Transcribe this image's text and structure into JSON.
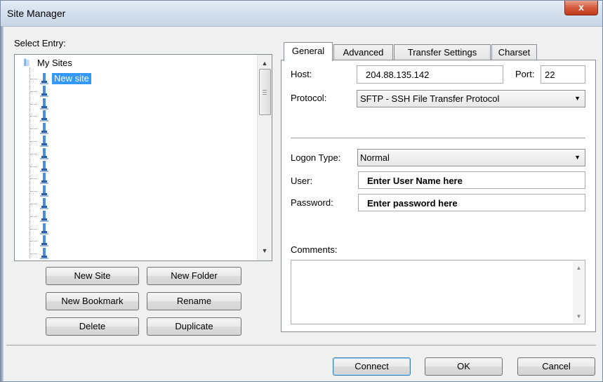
{
  "window": {
    "title": "Site Manager",
    "close_glyph": "x"
  },
  "select_entry_label": "Select Entry:",
  "tree": {
    "root_label": "My Sites",
    "selected_label": "New site",
    "site_count": 15
  },
  "buttons": {
    "new_site": "New Site",
    "new_folder": "New Folder",
    "new_bookmark": "New Bookmark",
    "rename": "Rename",
    "delete": "Delete",
    "duplicate": "Duplicate",
    "connect": "Connect",
    "ok": "OK",
    "cancel": "Cancel"
  },
  "tabs": [
    "General",
    "Advanced",
    "Transfer Settings",
    "Charset"
  ],
  "general": {
    "host_label": "Host:",
    "host_value": "204.88.135.142",
    "port_label": "Port:",
    "port_value": "22",
    "protocol_label": "Protocol:",
    "protocol_value": "SFTP - SSH File Transfer Protocol",
    "logon_type_label": "Logon Type:",
    "logon_type_value": "Normal",
    "user_label": "User:",
    "user_value": "Enter User Name here",
    "password_label": "Password:",
    "password_value": "Enter password here",
    "comments_label": "Comments:",
    "comments_value": ""
  },
  "colors": {
    "selection": "#3399ff",
    "close_button": "#c0391b",
    "site_icon": "#3a7fd0"
  }
}
